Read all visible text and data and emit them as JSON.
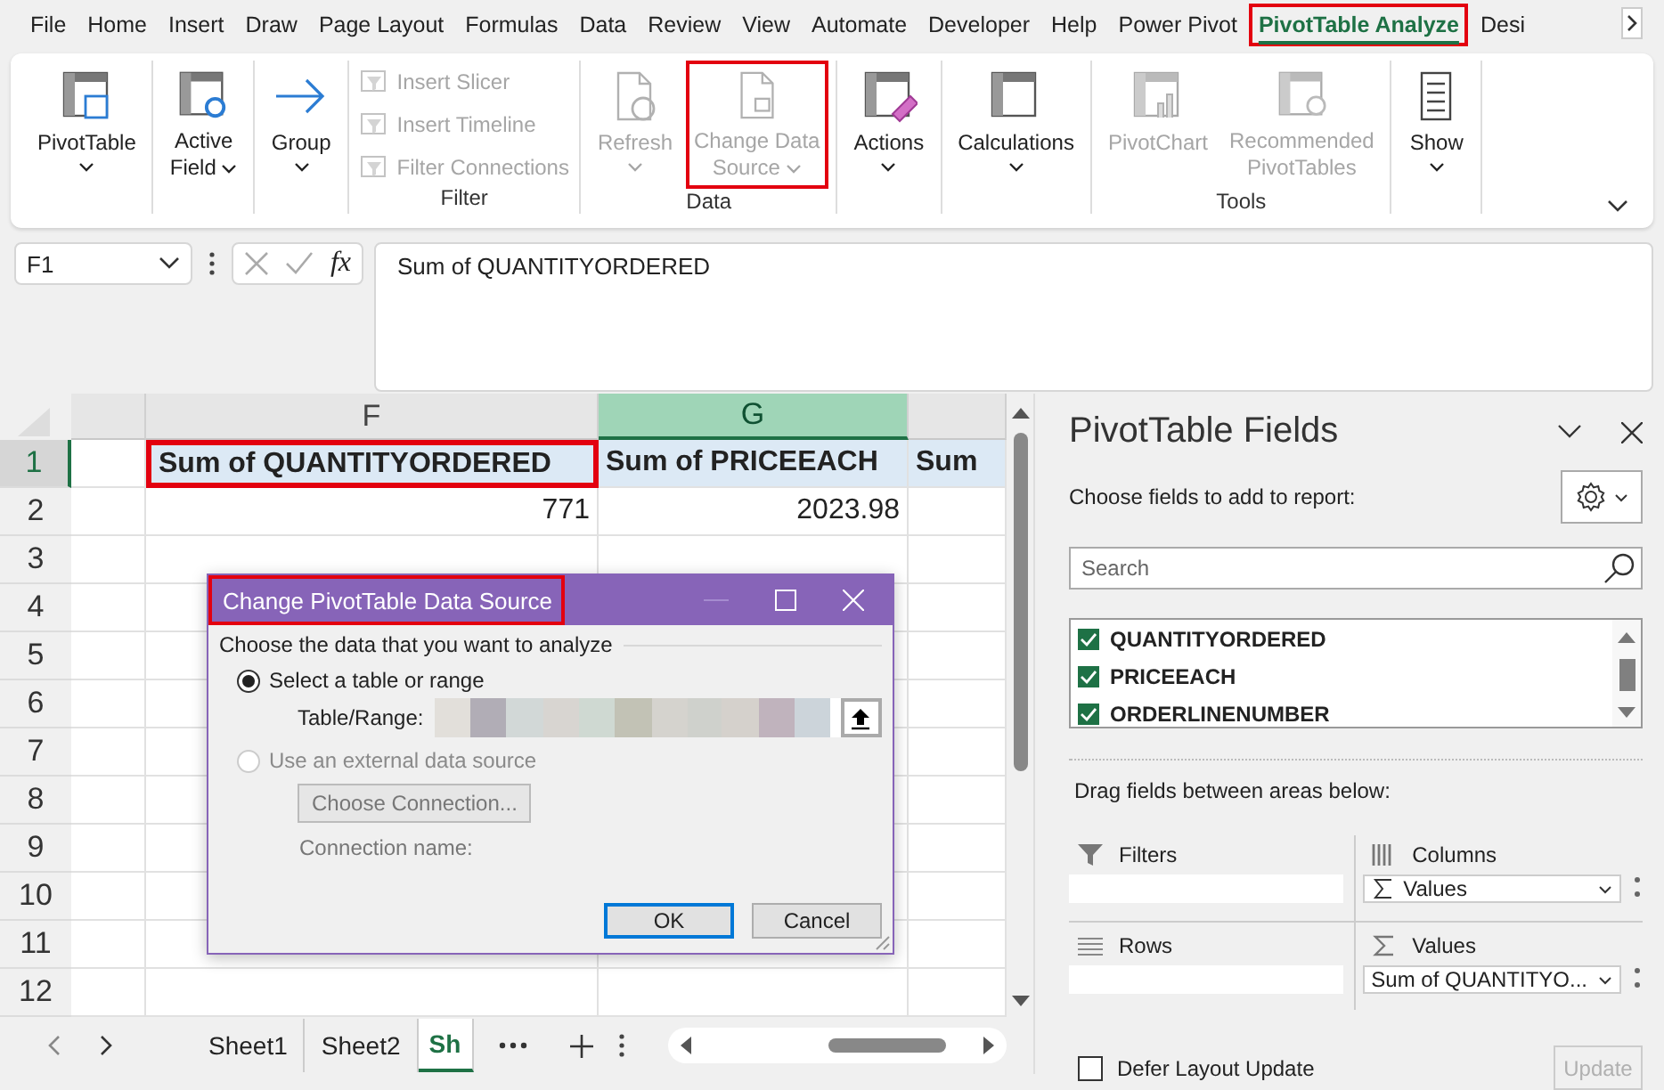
{
  "menu_tabs": [
    {
      "label": "File",
      "selected": false,
      "highlighted": false
    },
    {
      "label": "Home",
      "selected": false,
      "highlighted": false
    },
    {
      "label": "Insert",
      "selected": false,
      "highlighted": false
    },
    {
      "label": "Draw",
      "selected": false,
      "highlighted": false
    },
    {
      "label": "Page Layout",
      "selected": false,
      "highlighted": false
    },
    {
      "label": "Formulas",
      "selected": false,
      "highlighted": false
    },
    {
      "label": "Data",
      "selected": false,
      "highlighted": false
    },
    {
      "label": "Review",
      "selected": false,
      "highlighted": false
    },
    {
      "label": "View",
      "selected": false,
      "highlighted": false
    },
    {
      "label": "Automate",
      "selected": false,
      "highlighted": false
    },
    {
      "label": "Developer",
      "selected": false,
      "highlighted": false
    },
    {
      "label": "Help",
      "selected": false,
      "highlighted": false
    },
    {
      "label": "Power Pivot",
      "selected": false,
      "highlighted": false
    },
    {
      "label": "PivotTable Analyze",
      "selected": true,
      "highlighted": true
    },
    {
      "label": "Desi",
      "selected": false,
      "highlighted": false
    }
  ],
  "ribbon": {
    "groups": [
      {
        "buttons": [
          {
            "kind": "large",
            "label": "PivotTable",
            "dropdown": true,
            "disabled": false,
            "highlighted": false
          }
        ]
      },
      {
        "buttons": [
          {
            "kind": "large",
            "label": "Active\nField",
            "dropdown": true,
            "disabled": false,
            "highlighted": false
          }
        ]
      },
      {
        "buttons": [
          {
            "kind": "large",
            "label": "Group",
            "dropdown": true,
            "disabled": false,
            "highlighted": false
          }
        ]
      },
      {
        "label": "Filter",
        "buttons": [
          {
            "kind": "small",
            "label": "Insert Slicer",
            "disabled": true,
            "highlighted": false
          },
          {
            "kind": "small",
            "label": "Insert Timeline",
            "disabled": true,
            "highlighted": false
          },
          {
            "kind": "small",
            "label": "Filter Connections",
            "disabled": true,
            "highlighted": false
          }
        ]
      },
      {
        "label": "Data",
        "buttons": [
          {
            "kind": "large",
            "label": "Refresh",
            "dropdown": true,
            "disabled": true,
            "highlighted": false
          },
          {
            "kind": "large",
            "label": "Change Data\nSource",
            "dropdown": true,
            "disabled": true,
            "highlighted": true
          }
        ]
      },
      {
        "buttons": [
          {
            "kind": "large",
            "label": "Actions",
            "dropdown": true,
            "disabled": false,
            "highlighted": false
          }
        ]
      },
      {
        "buttons": [
          {
            "kind": "large",
            "label": "Calculations",
            "dropdown": true,
            "disabled": false,
            "highlighted": false
          }
        ]
      },
      {
        "label": "Tools",
        "buttons": [
          {
            "kind": "large",
            "label": "PivotChart",
            "disabled": true,
            "highlighted": false
          },
          {
            "kind": "large",
            "label": "Recommended\nPivotTables",
            "disabled": true,
            "highlighted": false
          }
        ]
      },
      {
        "buttons": [
          {
            "kind": "large",
            "label": "Show",
            "dropdown": true,
            "disabled": false,
            "highlighted": false
          }
        ]
      }
    ]
  },
  "formula_bar": {
    "name_box": "F1",
    "function_button": "fx",
    "formula": "Sum of QUANTITYORDERED"
  },
  "grid": {
    "columns": [
      {
        "selected": false
      },
      {
        "label": "F",
        "selected": false
      },
      {
        "label": "G",
        "selected": true
      },
      {
        "selected": false
      }
    ],
    "rows": [
      {
        "header": "1",
        "selected": true,
        "kind": "heading",
        "cells": [
          null,
          {
            "text": "Sum of QUANTITYORDERED",
            "highlighted": true
          },
          {
            "text": "Sum of PRICEEACH",
            "highlighted": false
          },
          {
            "text": "Sum",
            "highlighted": false
          }
        ]
      },
      {
        "header": "2",
        "selected": false,
        "kind": "value",
        "cells": [
          null,
          {
            "text": "771",
            "highlighted": false
          },
          {
            "text": "2023.98",
            "highlighted": false
          },
          null
        ]
      },
      {
        "header": "3",
        "selected": false
      },
      {
        "header": "4",
        "selected": false
      },
      {
        "header": "5",
        "selected": false
      },
      {
        "header": "6",
        "selected": false
      },
      {
        "header": "7",
        "selected": false
      },
      {
        "header": "8",
        "selected": false
      },
      {
        "header": "9",
        "selected": false
      },
      {
        "header": "10",
        "selected": false
      },
      {
        "header": "11",
        "selected": false
      },
      {
        "header": "12",
        "selected": false
      }
    ]
  },
  "sheet_tabs": [
    {
      "label": "Sheet1",
      "selected": false
    },
    {
      "label": "Sheet2",
      "selected": false
    },
    {
      "label": "Sh",
      "selected": true
    }
  ],
  "dialog": {
    "title": "Change PivotTable Data Source",
    "title_highlighted": true,
    "section": "Choose the data that you want to analyze",
    "options": [
      {
        "label": "Select a table or range",
        "selected": true,
        "disabled": false
      },
      {
        "label": "Use an external data source",
        "selected": false,
        "disabled": true
      }
    ],
    "range_label": "Table/Range:",
    "range_redacted": true,
    "choose_button": "Choose Connection...",
    "connection_label": "Connection name:",
    "buttons": [
      {
        "label": "OK",
        "default": true
      },
      {
        "label": "Cancel",
        "default": false
      }
    ]
  },
  "pane": {
    "title": "PivotTable Fields",
    "prompt": "Choose fields to add to report:",
    "search": {
      "placeholder": "Search"
    },
    "fields": [
      {
        "name": "QUANTITYORDERED",
        "checked": true
      },
      {
        "name": "PRICEEACH",
        "checked": true
      },
      {
        "name": "ORDERLINENUMBER",
        "checked": true
      }
    ],
    "drag_hint": "Drag fields between areas below:",
    "areas": [
      {
        "label": "Filters"
      },
      {
        "label": "Columns",
        "items": [
          "Values"
        ]
      },
      {
        "label": "Rows"
      },
      {
        "label": "Values",
        "items": [
          "Sum of QUANTITYO..."
        ]
      }
    ],
    "defer": {
      "label": "Defer Layout Update",
      "checked": false
    },
    "update_button": {
      "label": "Update",
      "disabled": true
    }
  }
}
